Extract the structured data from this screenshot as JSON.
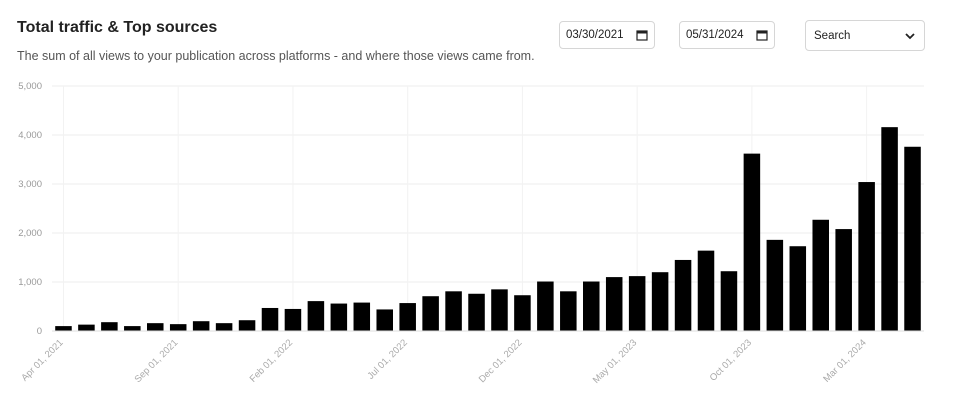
{
  "header": {
    "title": "Total traffic & Top sources",
    "subtitle": "The sum of all views to your publication across platforms - and where those views came from."
  },
  "filters": {
    "start_date": "03/30/2021",
    "end_date": "05/31/2024",
    "source_select": "Search"
  },
  "chart_data": {
    "type": "bar",
    "bar_color": "#000000",
    "grid": true,
    "ylim": [
      0,
      5000
    ],
    "yticks": [
      "5,000",
      "4,000",
      "3,000",
      "2,000",
      "1,000",
      "0"
    ],
    "ytick_values": [
      5000,
      4000,
      3000,
      2000,
      1000,
      0
    ],
    "categories": [
      "Apr 01, 2021",
      "May 01, 2021",
      "Jun 01, 2021",
      "Jul 01, 2021",
      "Aug 01, 2021",
      "Sep 01, 2021",
      "Oct 01, 2021",
      "Nov 01, 2021",
      "Dec 01, 2021",
      "Jan 01, 2022",
      "Feb 01, 2022",
      "Mar 01, 2022",
      "Apr 01, 2022",
      "May 01, 2022",
      "Jun 01, 2022",
      "Jul 01, 2022",
      "Aug 01, 2022",
      "Sep 01, 2022",
      "Oct 01, 2022",
      "Nov 01, 2022",
      "Dec 01, 2022",
      "Jan 01, 2023",
      "Feb 01, 2023",
      "Mar 01, 2023",
      "Apr 01, 2023",
      "May 01, 2023",
      "Jun 01, 2023",
      "Jul 01, 2023",
      "Aug 01, 2023",
      "Sep 01, 2023",
      "Oct 01, 2023",
      "Nov 01, 2023",
      "Dec 01, 2023",
      "Jan 01, 2024",
      "Feb 01, 2024",
      "Mar 01, 2024",
      "Apr 01, 2024",
      "May 01, 2024"
    ],
    "values": [
      100,
      130,
      180,
      100,
      160,
      140,
      200,
      160,
      220,
      470,
      450,
      610,
      560,
      580,
      440,
      570,
      710,
      810,
      760,
      850,
      730,
      1010,
      810,
      1010,
      1100,
      1120,
      1200,
      1450,
      1640,
      1220,
      3620,
      1860,
      1730,
      2270,
      2080,
      3040,
      4160,
      3760
    ],
    "xtick_labels": [
      {
        "index": 0,
        "label": "Apr 01, 2021"
      },
      {
        "index": 5,
        "label": "Sep 01, 2021"
      },
      {
        "index": 10,
        "label": "Feb 01, 2022"
      },
      {
        "index": 15,
        "label": "Jul 01, 2022"
      },
      {
        "index": 20,
        "label": "Dec 01, 2022"
      },
      {
        "index": 25,
        "label": "May 01, 2023"
      },
      {
        "index": 30,
        "label": "Oct 01, 2023"
      },
      {
        "index": 35,
        "label": "Mar 01, 2024"
      }
    ]
  }
}
